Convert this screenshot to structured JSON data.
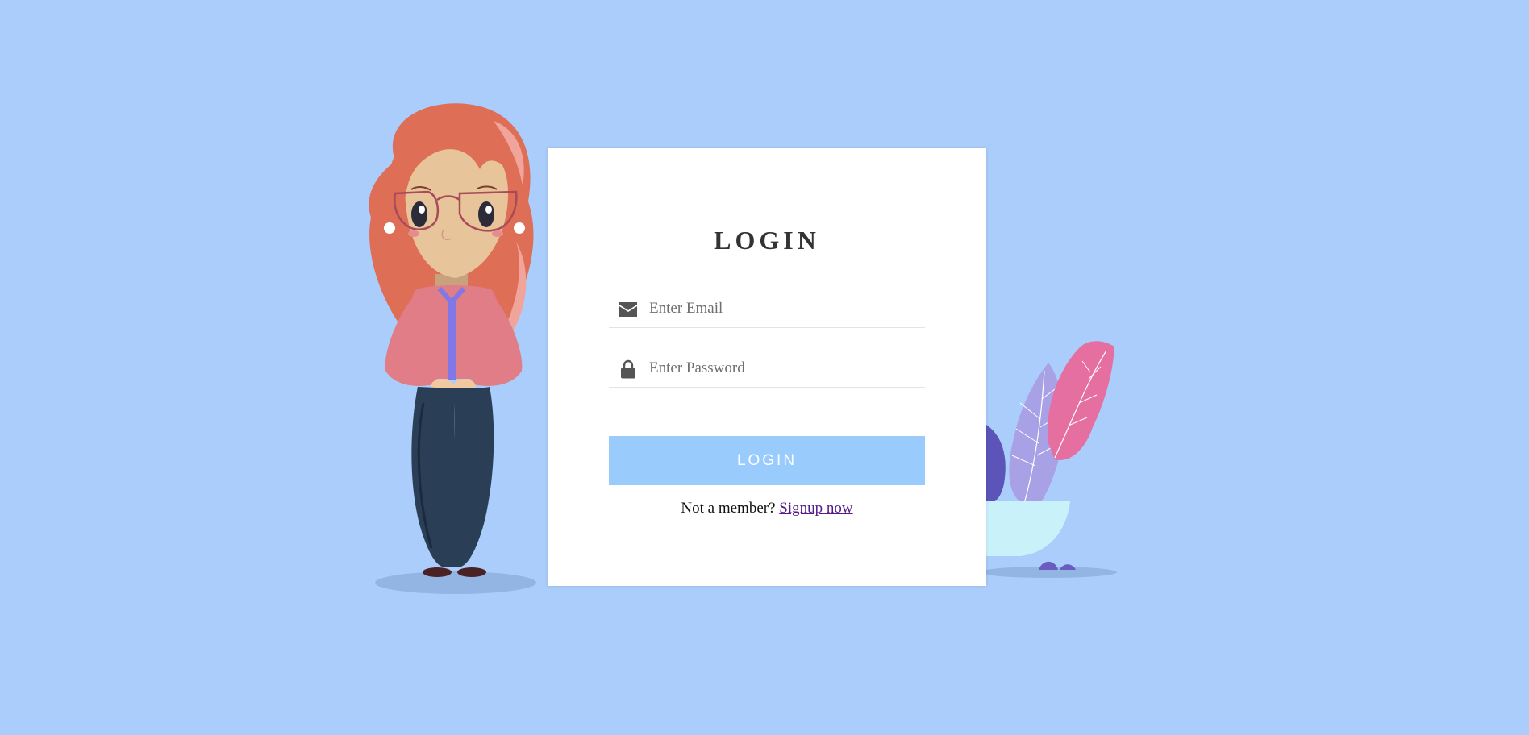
{
  "login": {
    "title": "LOGIN",
    "email_placeholder": "Enter Email",
    "password_placeholder": "Enter Password",
    "button_label": "LOGIN",
    "signup_prompt": "Not a member?",
    "signup_link": "Signup now"
  },
  "icons": {
    "email": "envelope-icon",
    "password": "lock-icon"
  },
  "colors": {
    "background": "#abcdfb",
    "card": "#ffffff",
    "button": "#99cbfc",
    "link": "#551a8b"
  }
}
